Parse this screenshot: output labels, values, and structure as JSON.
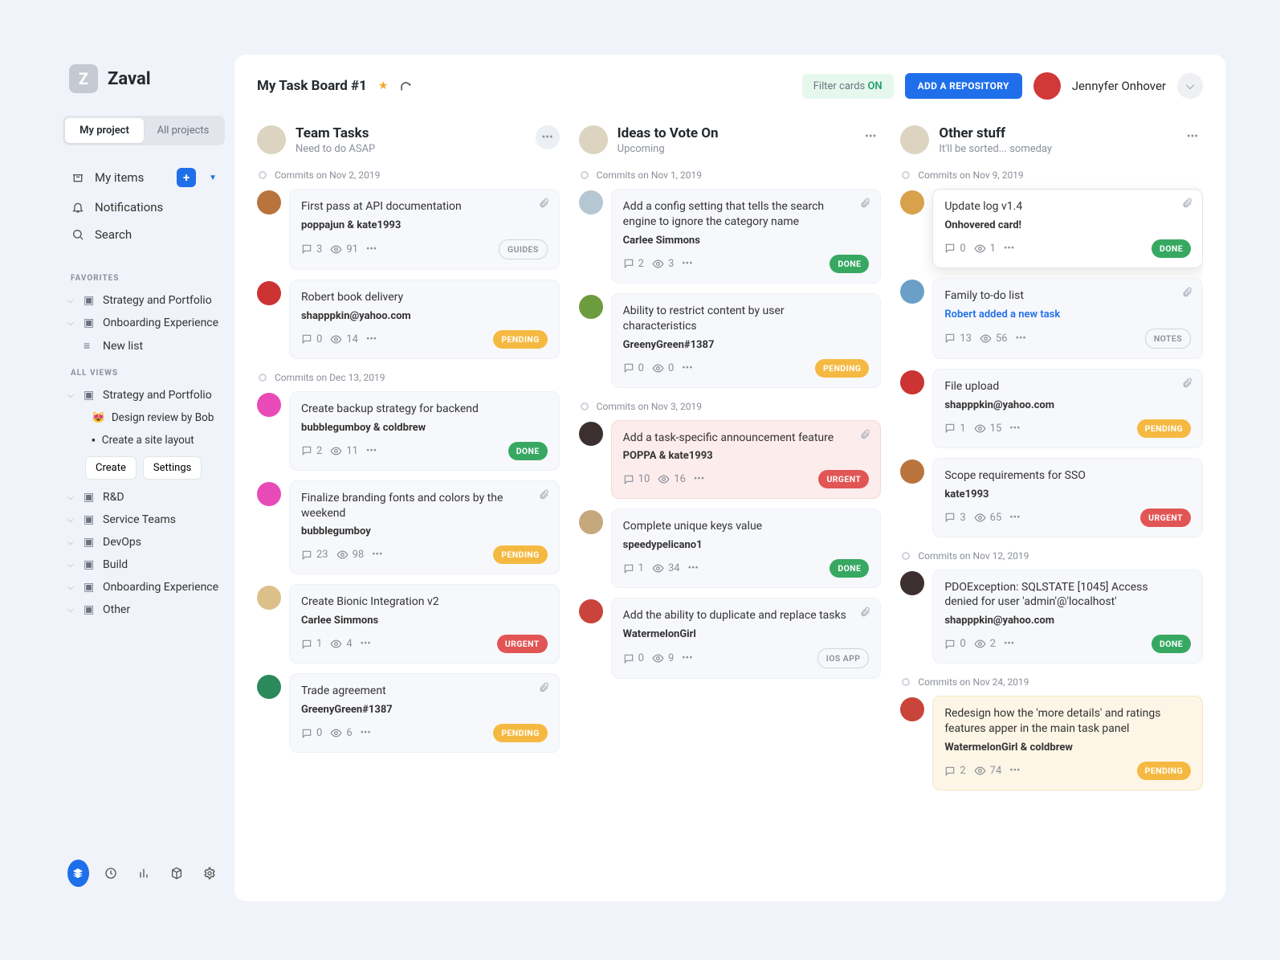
{
  "brand": {
    "name": "Zaval",
    "logo_letter": "Z"
  },
  "project_tabs": {
    "active": "My project",
    "other": "All projects"
  },
  "nav": {
    "my_items": "My items",
    "notifications": "Notifications",
    "search": "Search"
  },
  "favorites": {
    "label": "FAVORITES",
    "items": [
      "Strategy and Portfolio",
      "Onboarding Experience",
      "New list"
    ]
  },
  "all_views": {
    "label": "ALL VIEWS",
    "root": "Strategy and Portfolio",
    "children": [
      "Design review by Bob",
      "Create a site layout"
    ],
    "buttons": {
      "create": "Create",
      "settings": "Settings"
    },
    "rest": [
      "R&D",
      "Service Teams",
      "DevOps",
      "Build",
      "Onboarding Experience",
      "Other"
    ]
  },
  "topbar": {
    "title": "My Task Board #1",
    "filter_prefix": "Filter cards ",
    "filter_state": "ON",
    "add_repo": "ADD A REPOSITORY",
    "user": "Jennyfer Onhover"
  },
  "columns": [
    {
      "title": "Team Tasks",
      "subtitle": "Need to do ASAP",
      "groups": [
        {
          "label": "Commits on Nov 2, 2019",
          "cards": [
            {
              "av": "av1",
              "title": "First pass at API documentation",
              "author": "poppajun & kate1993",
              "comments": 3,
              "views": 91,
              "badge": "GUIDES",
              "badge_kind": "outline",
              "clip": true
            },
            {
              "av": "av2",
              "title": "Robert book delivery",
              "author": "shapppkin@yahoo.com",
              "comments": 0,
              "views": 14,
              "badge": "PENDING",
              "badge_kind": "pending"
            }
          ]
        },
        {
          "label": "Commits on Dec 13, 2019",
          "cards": [
            {
              "av": "av3",
              "title": "Create backup strategy for backend",
              "author": "bubblegumboy & coldbrew",
              "comments": 2,
              "views": 11,
              "badge": "DONE",
              "badge_kind": "done"
            },
            {
              "av": "av3",
              "title": "Finalize branding fonts and colors by the weekend",
              "author": "bubblegumboy",
              "comments": 23,
              "views": 98,
              "badge": "PENDING",
              "badge_kind": "pending",
              "clip": true
            },
            {
              "av": "av4",
              "title": "Create Bionic Integration v2",
              "author": "Carlee Simmons",
              "comments": 1,
              "views": 4,
              "badge": "URGENT",
              "badge_kind": "urgent"
            },
            {
              "av": "av5",
              "title": "Trade agreement",
              "author": "GreenyGreen#1387",
              "comments": 0,
              "views": 6,
              "badge": "PENDING",
              "badge_kind": "pending",
              "clip": true
            }
          ]
        }
      ]
    },
    {
      "title": "Ideas to Vote On",
      "subtitle": "Upcoming",
      "groups": [
        {
          "label": "Commits on Nov 1, 2019",
          "cards": [
            {
              "av": "av6",
              "title": "Add a config setting that tells the search engine to ignore the category name",
              "author": "Carlee Simmons",
              "comments": 2,
              "views": 3,
              "badge": "DONE",
              "badge_kind": "done",
              "clip": true
            },
            {
              "av": "av7",
              "title": "Ability to restrict content by user characteristics",
              "author": "GreenyGreen#1387",
              "comments": 0,
              "views": 0,
              "badge": "PENDING",
              "badge_kind": "pending"
            }
          ]
        },
        {
          "label": "Commits on Nov 3, 2019",
          "cards": [
            {
              "av": "av8",
              "title": "Add a task-specific announcement feature",
              "author": "POPPA & kate1993",
              "comments": 10,
              "views": 16,
              "badge": "URGENT",
              "badge_kind": "urgent",
              "clip": true,
              "variant": "red"
            },
            {
              "av": "av9",
              "title": "Complete unique keys value",
              "author": "speedypelicano1",
              "comments": 1,
              "views": 34,
              "badge": "DONE",
              "badge_kind": "done"
            },
            {
              "av": "av10",
              "title": "Add the ability to duplicate and replace tasks",
              "author": "WatermelonGirl",
              "comments": 0,
              "views": 9,
              "badge": "IOS APP",
              "badge_kind": "outline",
              "clip": true
            }
          ]
        }
      ]
    },
    {
      "title": "Other stuff",
      "subtitle": "It'll be sorted... someday",
      "groups": [
        {
          "label": "Commits on Nov 9, 2019",
          "cards": [
            {
              "av": "av11",
              "title": "Update log v1.4",
              "author": "Onhovered card!",
              "comments": 0,
              "views": 1,
              "badge": "DONE",
              "badge_kind": "done",
              "clip": true,
              "variant": "hov"
            },
            {
              "av": "av12",
              "title": "Family to-do list",
              "link": "Robert added a new task",
              "comments": 13,
              "views": 56,
              "badge": "NOTES",
              "badge_kind": "outline",
              "clip": true
            },
            {
              "av": "av2",
              "title": "File upload",
              "author": "shapppkin@yahoo.com",
              "comments": 1,
              "views": 15,
              "badge": "PENDING",
              "badge_kind": "pending",
              "clip": true
            },
            {
              "av": "av1",
              "title": "Scope requirements for SSO",
              "author": "kate1993",
              "comments": 3,
              "views": 65,
              "badge": "URGENT",
              "badge_kind": "urgent"
            }
          ]
        },
        {
          "label": "Commits on Nov 12, 2019",
          "cards": [
            {
              "av": "av8",
              "title": "PDOException: SQLSTATE [1045] Access denied for user 'admin'@'localhost'",
              "author": "shapppkin@yahoo.com",
              "comments": 0,
              "views": 2,
              "badge": "DONE",
              "badge_kind": "done"
            }
          ]
        },
        {
          "label": "Commits on Nov 24, 2019",
          "cards": [
            {
              "av": "av10",
              "title": "Redesign how the 'more details' and ratings features apper in the main task panel",
              "author": "WatermelonGirl & coldbrew",
              "comments": 2,
              "views": 74,
              "badge": "PENDING",
              "badge_kind": "pending",
              "variant": "yellow"
            }
          ]
        }
      ]
    }
  ]
}
